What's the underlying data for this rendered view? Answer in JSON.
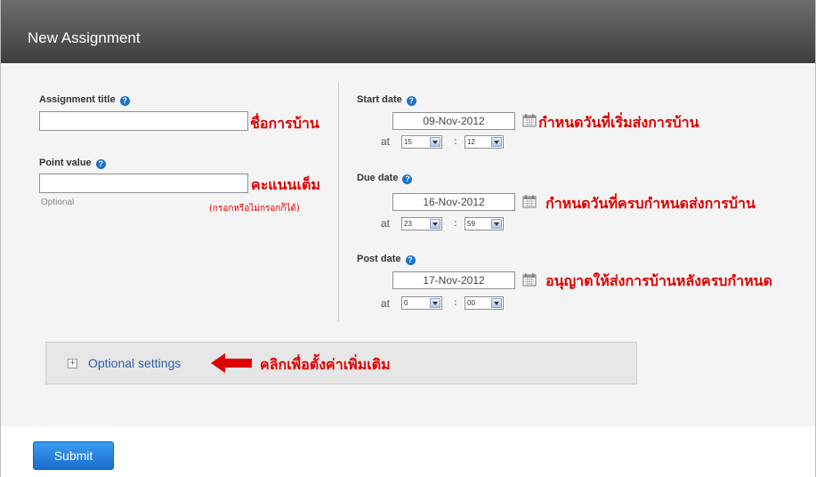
{
  "header": {
    "title": "New Assignment"
  },
  "left": {
    "assignment_title_label": "Assignment title",
    "point_value_label": "Point value",
    "optional_hint": "Optional"
  },
  "right": {
    "start": {
      "label": "Start date",
      "date": "09-Nov-2012",
      "hour": "15",
      "minute": "12"
    },
    "due": {
      "label": "Due date",
      "date": "16-Nov-2012",
      "hour": "23",
      "minute": "59"
    },
    "post": {
      "label": "Post date",
      "date": "17-Nov-2012",
      "hour": "0",
      "minute": "00"
    },
    "at_label": "at",
    "colon": ":"
  },
  "optional_settings": {
    "label": "Optional settings",
    "expander": "+"
  },
  "submit_label": "Submit",
  "annotations": {
    "title_note": "ชื่อการบ้าน",
    "points_note": "คะแนนเต็ม",
    "points_sub": "(กรอกหรือไม่กรอกก็ได้)",
    "start_note": "กำหนดวันที่เริ่มส่งการบ้าน",
    "due_note": "กำหนดวันที่ครบกำหนดส่งการบ้าน",
    "post_note": "อนุญาตให้ส่งการบ้านหลังครบกำหนด",
    "optional_note": "คลิกเพื่อตั้งค่าเพิ่มเติม"
  },
  "colors": {
    "accent": "#1a72c9",
    "annotation": "#e00000",
    "header": "#4a4a4a"
  },
  "icons": {
    "help": "question-circle-icon",
    "calendar": "calendar-icon",
    "arrow": "red-arrow-left-icon"
  }
}
